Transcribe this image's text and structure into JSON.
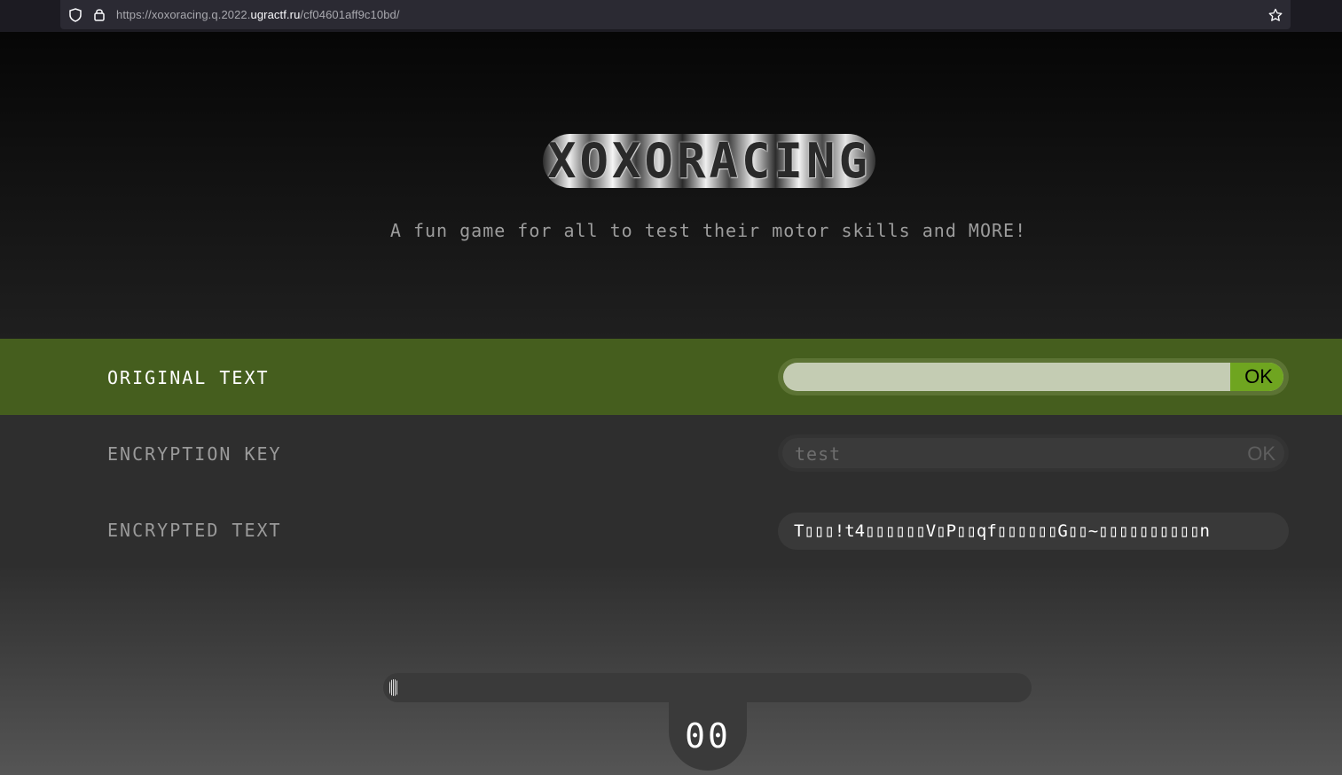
{
  "browser": {
    "url_prefix": "https://xoxoracing.q.2022.",
    "url_domain": "ugractf.ru",
    "url_path": "/cf04601aff9c10bd/",
    "icons": [
      "shield-icon",
      "lock-icon",
      "star-icon"
    ]
  },
  "hero": {
    "logo": "XOXORACING",
    "tagline": "A fun game for all to test their motor skills and MORE!"
  },
  "rows": {
    "original": {
      "label": "ORIGINAL TEXT",
      "value": "",
      "ok_label": "OK"
    },
    "key": {
      "label": "ENCRYPTION KEY",
      "value": "test",
      "ok_label": "OK"
    },
    "encrypted": {
      "label": "ENCRYPTED TEXT",
      "value": "T▯▯▯!t4▯▯▯▯▯▯V▯P▯▯qf▯▯▯▯▯▯G▯▯~▯▯▯▯▯▯▯▯▯▯n"
    }
  },
  "game": {
    "counter": "00",
    "progress": 0
  },
  "colors": {
    "accent_green": "#455e1e",
    "ok_green": "#6fa520"
  }
}
